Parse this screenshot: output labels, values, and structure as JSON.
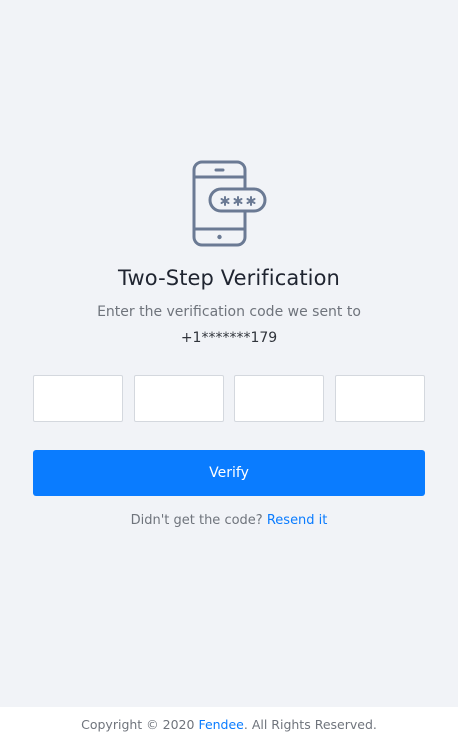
{
  "verification": {
    "icon": "phone-password-icon",
    "title": "Two-Step Verification",
    "subtitle": "Enter the verification code we sent to",
    "phone_number": "+1*******179",
    "code_inputs": [
      "",
      "",
      "",
      ""
    ],
    "verify_label": "Verify",
    "resend_prompt": "Didn't get the code?",
    "resend_link": "Resend it"
  },
  "footer": {
    "prefix": "Copyright © 2020 ",
    "brand": "Fendee",
    "suffix": ". All Rights Reserved."
  },
  "colors": {
    "accent": "#0a7cff",
    "background": "#f1f3f7",
    "icon": "#6b7a94"
  }
}
